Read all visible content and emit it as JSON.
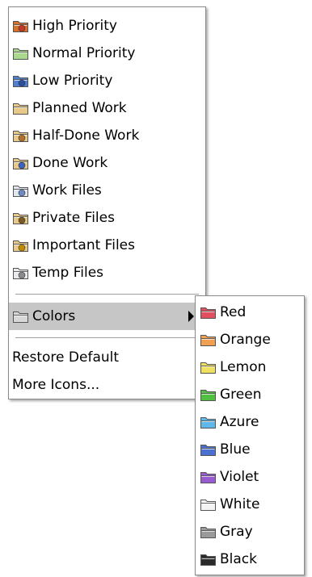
{
  "main_menu": {
    "items": [
      {
        "label": "High Priority",
        "icon": "high-priority-folder-icon",
        "color": "#d9702a",
        "badge": "#c0392b"
      },
      {
        "label": "Normal Priority",
        "icon": "normal-priority-folder-icon",
        "color": "#a8d98c",
        "badge": ""
      },
      {
        "label": "Low Priority",
        "icon": "low-priority-folder-icon",
        "color": "#4f7fd0",
        "badge": "#2c4fa0"
      },
      {
        "label": "Planned Work",
        "icon": "planned-work-folder-icon",
        "color": "#e9c98a",
        "badge": ""
      },
      {
        "label": "Half-Done Work",
        "icon": "half-done-work-folder-icon",
        "color": "#e9c98a",
        "badge": "#b07030"
      },
      {
        "label": "Done Work",
        "icon": "done-work-folder-icon",
        "color": "#e9c98a",
        "badge": "#3a64c0"
      },
      {
        "label": "Work Files",
        "icon": "work-files-icon",
        "color": "#e0e6ef",
        "badge": "#6b8ac0"
      },
      {
        "label": "Private Files",
        "icon": "private-files-folder-icon",
        "color": "#e9c98a",
        "badge": "#7a5a20"
      },
      {
        "label": "Important Files",
        "icon": "important-files-folder-icon",
        "color": "#e9c98a",
        "badge": "#c08a00"
      },
      {
        "label": "Temp Files",
        "icon": "temp-files-icon",
        "color": "#e8eaee",
        "badge": "#8a8a8a"
      }
    ],
    "colors_item": {
      "label": "Colors",
      "icon": "colors-folder-icon",
      "color": "#d8d8d8"
    },
    "restore_default": "Restore Default",
    "more_icons": "More Icons..."
  },
  "colors_submenu": {
    "items": [
      {
        "label": "Red",
        "icon": "red-folder-icon",
        "color": "#e05060"
      },
      {
        "label": "Orange",
        "icon": "orange-folder-icon",
        "color": "#f0a050"
      },
      {
        "label": "Lemon",
        "icon": "lemon-folder-icon",
        "color": "#f0e060"
      },
      {
        "label": "Green",
        "icon": "green-folder-icon",
        "color": "#50c040"
      },
      {
        "label": "Azure",
        "icon": "azure-folder-icon",
        "color": "#60b8e8"
      },
      {
        "label": "Blue",
        "icon": "blue-folder-icon",
        "color": "#4a70d0"
      },
      {
        "label": "Violet",
        "icon": "violet-folder-icon",
        "color": "#9a5ad0"
      },
      {
        "label": "White",
        "icon": "white-folder-icon",
        "color": "#f4f4f4"
      },
      {
        "label": "Gray",
        "icon": "gray-folder-icon",
        "color": "#9a9a9a"
      },
      {
        "label": "Black",
        "icon": "black-folder-icon",
        "color": "#2a2a2a"
      }
    ]
  },
  "colors": {
    "highlight": "#c6c6c6",
    "border": "#8a8a8a"
  }
}
